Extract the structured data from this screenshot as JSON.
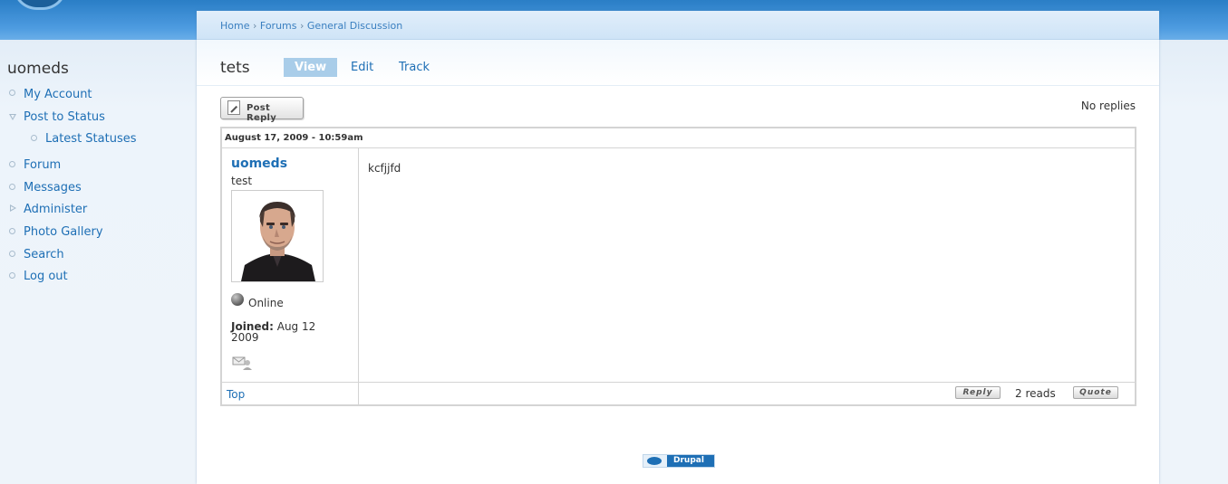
{
  "sidebar": {
    "site_name": "uomeds",
    "items": [
      {
        "label": "My Account"
      },
      {
        "label": "Post to Status"
      },
      {
        "label": "Latest Statuses"
      },
      {
        "label": "Forum"
      },
      {
        "label": "Messages"
      },
      {
        "label": "Administer"
      },
      {
        "label": "Photo Gallery"
      },
      {
        "label": "Search"
      },
      {
        "label": "Log out"
      }
    ]
  },
  "breadcrumb": {
    "items": [
      "Home",
      "Forums",
      "General Discussion"
    ],
    "separator": "›"
  },
  "page": {
    "title": "tets",
    "tabs": [
      {
        "label": "View",
        "active": true
      },
      {
        "label": "Edit",
        "active": false
      },
      {
        "label": "Track",
        "active": false
      }
    ]
  },
  "toolbar": {
    "post_reply_label": "Post Reply",
    "replies_status": "No replies"
  },
  "post": {
    "date": "August 17, 2009 - 10:59am",
    "author": {
      "name": "uomeds",
      "role": "test",
      "status": "Online",
      "joined_label": "Joined:",
      "joined_value": "Aug 12 2009"
    },
    "body": "kcfjjfd",
    "footer": {
      "top_link": "Top",
      "reply_label": "Reply",
      "reads": "2 reads",
      "quote_label": "Quote"
    }
  },
  "footer": {
    "badge_label": "Drupal"
  },
  "colors": {
    "link": "#1e6fb5",
    "header_band": "#2a7ec6",
    "active_tab": "#a9cde9"
  }
}
